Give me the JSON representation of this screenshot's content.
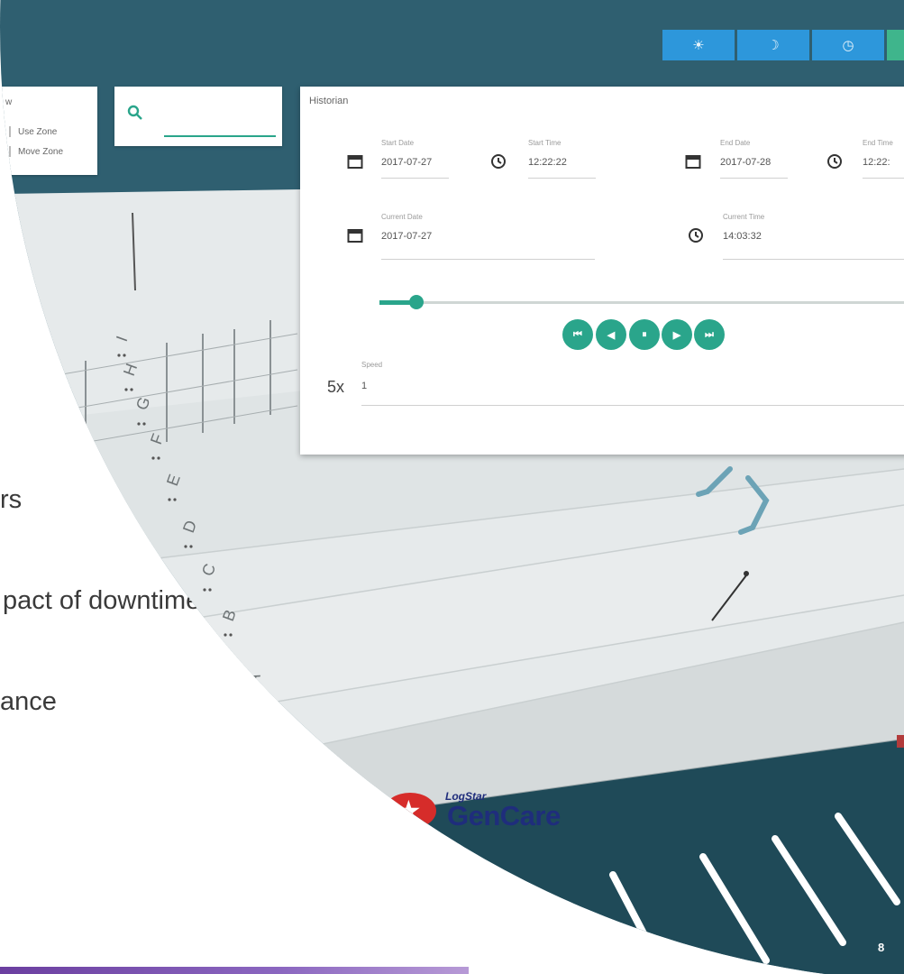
{
  "toolbar": {
    "buttons": [
      {
        "icon": "sun-icon",
        "glyph": "☀"
      },
      {
        "icon": "moon-icon",
        "glyph": "☽"
      },
      {
        "icon": "clock-icon",
        "glyph": "◷"
      }
    ]
  },
  "zone_panel": {
    "header": "w",
    "items": [
      "Use Zone",
      "Move Zone"
    ]
  },
  "search": {
    "icon": "search-icon",
    "glyph": "🔍",
    "placeholder": ""
  },
  "historian": {
    "title": "Historian",
    "start_date_label": "Start Date",
    "start_date": "2017-07-27",
    "start_time_label": "Start Time",
    "start_time": "12:22:22",
    "end_date_label": "End Date",
    "end_date": "2017-07-28",
    "end_time_label": "End Time",
    "end_time": "12:22:",
    "current_date_label": "Current Date",
    "current_date": "2017-07-27",
    "current_time_label": "Current Time",
    "current_time": "14:03:32",
    "playback_position": 0.06,
    "controls": [
      {
        "name": "skip-start-button",
        "glyph": "⏮"
      },
      {
        "name": "step-back-button",
        "glyph": "◀"
      },
      {
        "name": "pause-button",
        "glyph": "⏸"
      },
      {
        "name": "play-button",
        "glyph": "▶"
      },
      {
        "name": "skip-end-button",
        "glyph": "⏭"
      }
    ],
    "speed_display": "5x",
    "speed_label": "Speed",
    "speed_value": "1"
  },
  "slide": {
    "fragments": [
      "rs",
      "pact of downtime",
      "ance"
    ]
  },
  "scene": {
    "aisle_labels": [
      "I",
      "H",
      "G",
      "F",
      "E",
      "D",
      "C",
      "B",
      "A"
    ]
  },
  "logo": {
    "small": "LogStar",
    "big": "GenCare"
  },
  "page_number": "8",
  "colors": {
    "accent_teal": "#2aa58b",
    "toolbar_blue": "#2d97db",
    "logo_red": "#d62c2a",
    "logo_navy": "#1f2d7c"
  }
}
